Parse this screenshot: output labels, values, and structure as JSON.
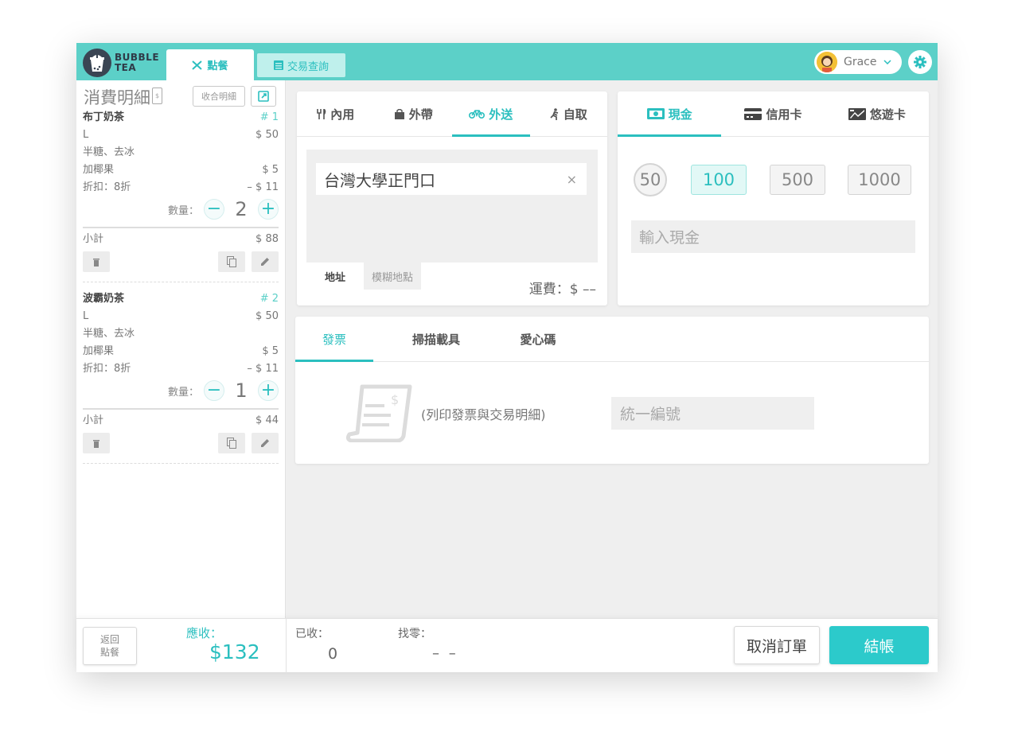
{
  "brand": {
    "line1": "BUBBLE",
    "line2": "TEA"
  },
  "nav": {
    "order_tab": "點餐",
    "query_tab": "交易查詢"
  },
  "user": {
    "name": "Grace"
  },
  "order": {
    "title": "消費明細",
    "collapse_label": "收合明細",
    "items": [
      {
        "name": "布丁奶茶",
        "number": "# 1",
        "size": "L",
        "size_price": "$ 50",
        "options": "半糖、去冰",
        "topping": "加椰果",
        "topping_price": "$ 5",
        "discount": "折扣：8折",
        "discount_price": "– $ 11",
        "qty_label": "數量：",
        "qty": "2",
        "subtotal_label": "小計",
        "subtotal": "$ 88"
      },
      {
        "name": "波霸奶茶",
        "number": "# 2",
        "size": "L",
        "size_price": "$ 50",
        "options": "半糖、去冰",
        "topping": "加椰果",
        "topping_price": "$ 5",
        "discount": "折扣：8折",
        "discount_price": "– $ 11",
        "qty_label": "數量：",
        "qty": "1",
        "subtotal_label": "小計",
        "subtotal": "$ 44"
      }
    ]
  },
  "dining": {
    "tabs": [
      "內用",
      "外帶",
      "外送",
      "自取"
    ],
    "active_tab": "外送",
    "address_value": "台灣大學正門口",
    "address_tabs": [
      "地址",
      "模糊地點"
    ],
    "fee": "運費：$ ––"
  },
  "payment": {
    "tabs": [
      "現金",
      "信用卡",
      "悠遊卡"
    ],
    "active_tab": "現金",
    "denominations": [
      "50",
      "100",
      "500",
      "1000"
    ],
    "selected": "100",
    "cash_placeholder": "輸入現金"
  },
  "invoice": {
    "tabs": [
      "發票",
      "掃描載具",
      "愛心碼"
    ],
    "active_tab": "發票",
    "print_note": "(列印發票與交易明細)",
    "ubn_placeholder": "統一編號"
  },
  "footer": {
    "back_line1": "返回",
    "back_line2": "點餐",
    "due_label": "應收：",
    "due_value": "$132",
    "received_label": "已收：",
    "received_value": "0",
    "change_label": "找零：",
    "change_value": "– –",
    "cancel_label": "取消訂單",
    "checkout_label": "結帳"
  },
  "colors": {
    "accent": "#2bbfbf",
    "topbar": "#5cd0c8"
  }
}
